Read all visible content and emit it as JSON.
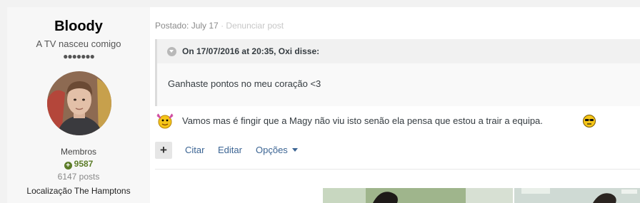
{
  "author": {
    "name": "Bloody",
    "title": "A TV nasceu comigo",
    "rank_pips": "●●●●●●●",
    "group": "Membros",
    "reputation": "9587",
    "post_count": "6147 posts",
    "location": "Localização The Hamptons"
  },
  "post": {
    "meta_posted": "Postado: July 17",
    "meta_sep": " · ",
    "meta_report": "Denunciar post",
    "quote": {
      "citation": "On 17/07/2016 at 20:35, Oxi disse:",
      "body": "Ganhaste pontos no meu coração <3"
    },
    "content_text": "Vamos mas é fingir que a Magy não viu isto senão ela pensa que estou a trair a equipa.",
    "emoji_left": "dancing-smiley-icon",
    "emoji_right": "cool-smiley-icon"
  },
  "actions": {
    "multiquote": "+",
    "quote": "Citar",
    "edit": "Editar",
    "options": "Opções"
  },
  "colors": {
    "link": "#3b6493",
    "reputation": "#5c7c28",
    "author_panel": "#f7f7f7",
    "quote_header": "#f1f1f1"
  }
}
